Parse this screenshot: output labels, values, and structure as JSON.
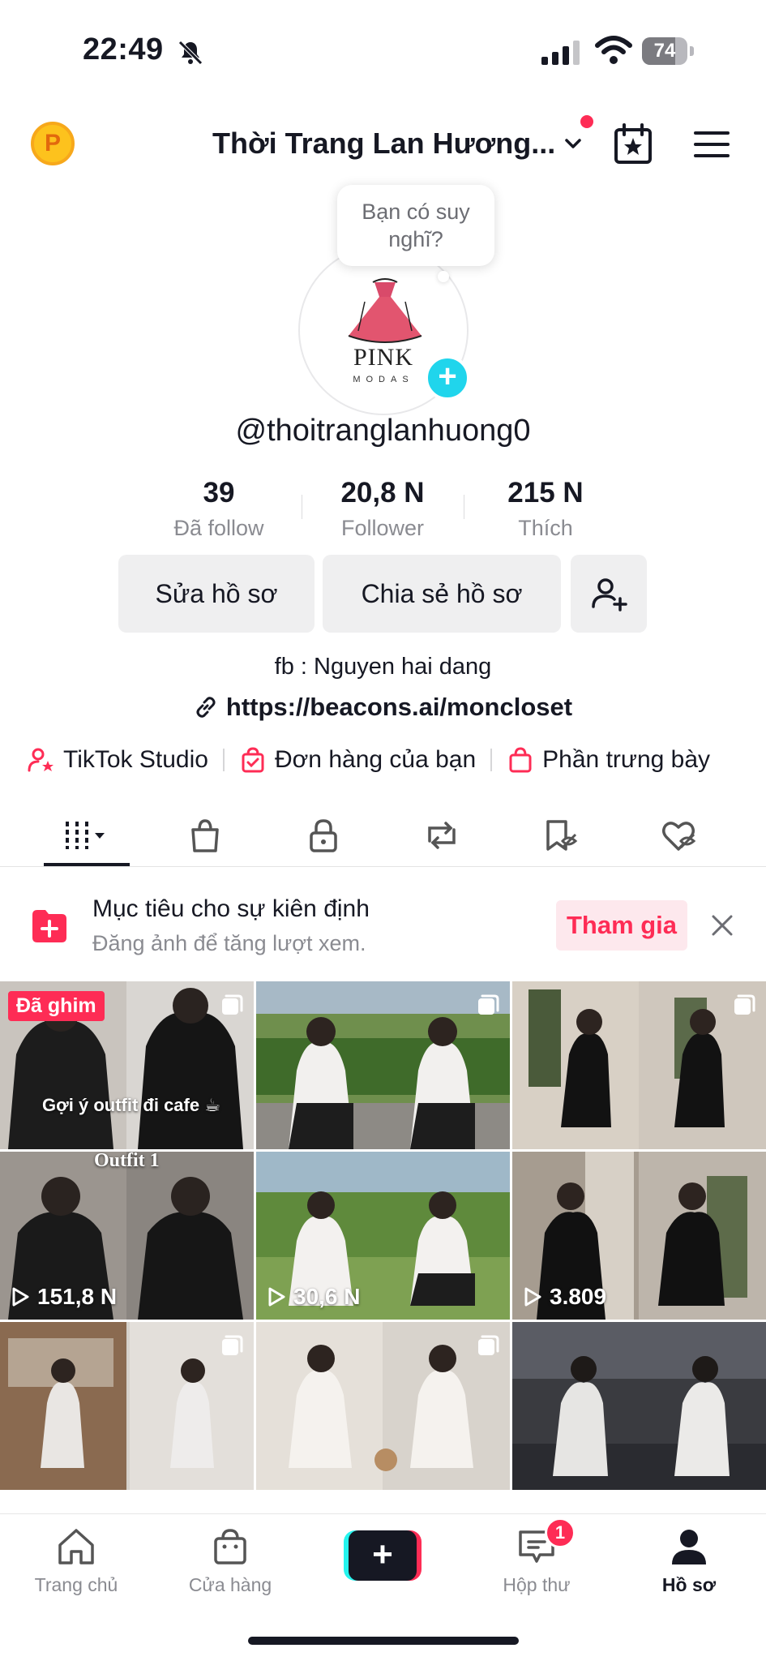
{
  "status_bar": {
    "time": "22:49",
    "battery": "74",
    "battery_level": 0.74
  },
  "header": {
    "account_name": "Thời Trang Lan Hương...",
    "coin_letter": "P"
  },
  "profile": {
    "thought_bubble": "Bạn có suy nghĩ?",
    "avatar_brand": "PINK",
    "avatar_sub": "MODAS",
    "username": "@thoitranglanhuong0",
    "stats": [
      {
        "value": "39",
        "label": "Đã follow"
      },
      {
        "value": "20,8 N",
        "label": "Follower"
      },
      {
        "value": "215 N",
        "label": "Thích"
      }
    ],
    "edit_profile_label": "Sửa hồ sơ",
    "share_profile_label": "Chia sẻ hồ sơ",
    "bio": "fb : Nguyen hai dang",
    "link": "https://beacons.ai/moncloset"
  },
  "shortcuts": [
    {
      "label": "TikTok Studio",
      "icon": "person-star-icon"
    },
    {
      "label": "Đơn hàng của bạn",
      "icon": "order-bag-icon"
    },
    {
      "label": "Phần trưng bày",
      "icon": "showcase-bag-icon"
    }
  ],
  "tabs": [
    {
      "icon": "grid-icon",
      "active": true
    },
    {
      "icon": "shop-bag-icon"
    },
    {
      "icon": "lock-icon"
    },
    {
      "icon": "repost-icon"
    },
    {
      "icon": "saved-icon"
    },
    {
      "icon": "liked-icon"
    }
  ],
  "goal_banner": {
    "title": "Mục tiêu cho sự kiên định",
    "subtitle": "Đăng ảnh để tăng lượt xem.",
    "join_label": "Tham gia"
  },
  "videos": [
    {
      "badge": "Đã ghim",
      "caption": "Gợi ý outfit đi cafe ☕",
      "multi": true,
      "views": ""
    },
    {
      "badge": "",
      "caption": "",
      "multi": true,
      "views": ""
    },
    {
      "badge": "",
      "caption": "",
      "multi": true,
      "views": ""
    },
    {
      "badge": "",
      "caption": "Outfit 1",
      "multi": false,
      "views": "151,8 N"
    },
    {
      "badge": "",
      "caption": "",
      "multi": false,
      "views": "30,6 N"
    },
    {
      "badge": "",
      "caption": "",
      "multi": false,
      "views": "3.809"
    },
    {
      "badge": "",
      "caption": "",
      "multi": true,
      "views": ""
    },
    {
      "badge": "",
      "caption": "",
      "multi": true,
      "views": ""
    },
    {
      "badge": "",
      "caption": "",
      "multi": false,
      "views": ""
    }
  ],
  "bottom_nav": [
    {
      "label": "Trang chủ",
      "icon": "home-icon"
    },
    {
      "label": "Cửa hàng",
      "icon": "shop-icon"
    },
    {
      "label": "",
      "icon": "create-icon"
    },
    {
      "label": "Hộp thư",
      "icon": "inbox-icon",
      "badge": "1"
    },
    {
      "label": "Hồ sơ",
      "icon": "profile-icon",
      "active": true
    }
  ],
  "colors": {
    "accent": "#fe2c55",
    "cyan": "#25f4ee",
    "text": "#161823",
    "muted": "#8a8b91"
  }
}
